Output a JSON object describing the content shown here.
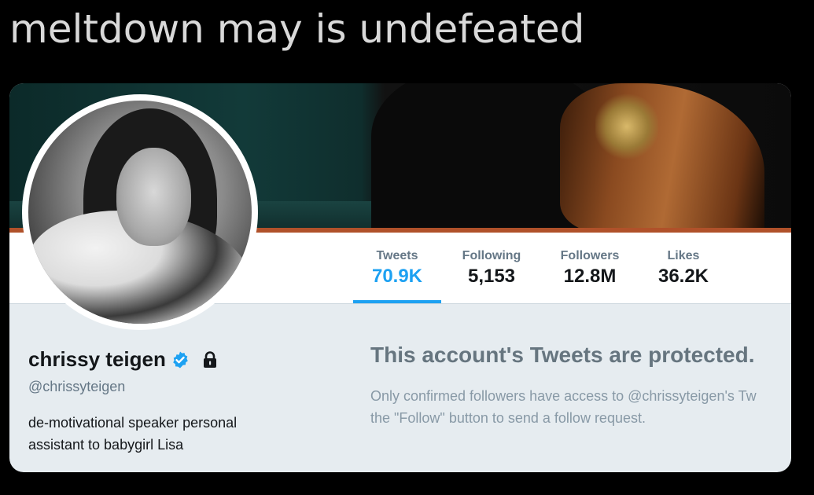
{
  "caption": "meltdown may is undefeated",
  "profile": {
    "name": "chrissy teigen",
    "handle": "@chrissyteigen",
    "bio_line1": "de-motivational speaker personal",
    "bio_line2": "assistant to babygirl Lisa",
    "verified_icon": "verified-badge-icon",
    "protected_icon": "lock-icon"
  },
  "stats": [
    {
      "label": "Tweets",
      "value": "70.9K",
      "active": true
    },
    {
      "label": "Following",
      "value": "5,153",
      "active": false
    },
    {
      "label": "Followers",
      "value": "12.8M",
      "active": false
    },
    {
      "label": "Likes",
      "value": "36.2K",
      "active": false
    }
  ],
  "protected": {
    "title": "This account's Tweets are protected.",
    "line1": "Only confirmed followers have access to @chrissyteigen's Tw",
    "line2": "the \"Follow\" button to send a follow request."
  },
  "colors": {
    "accent": "#1da1f2",
    "background": "#e6ecf0",
    "text_primary": "#14171a",
    "text_secondary": "#657786"
  }
}
